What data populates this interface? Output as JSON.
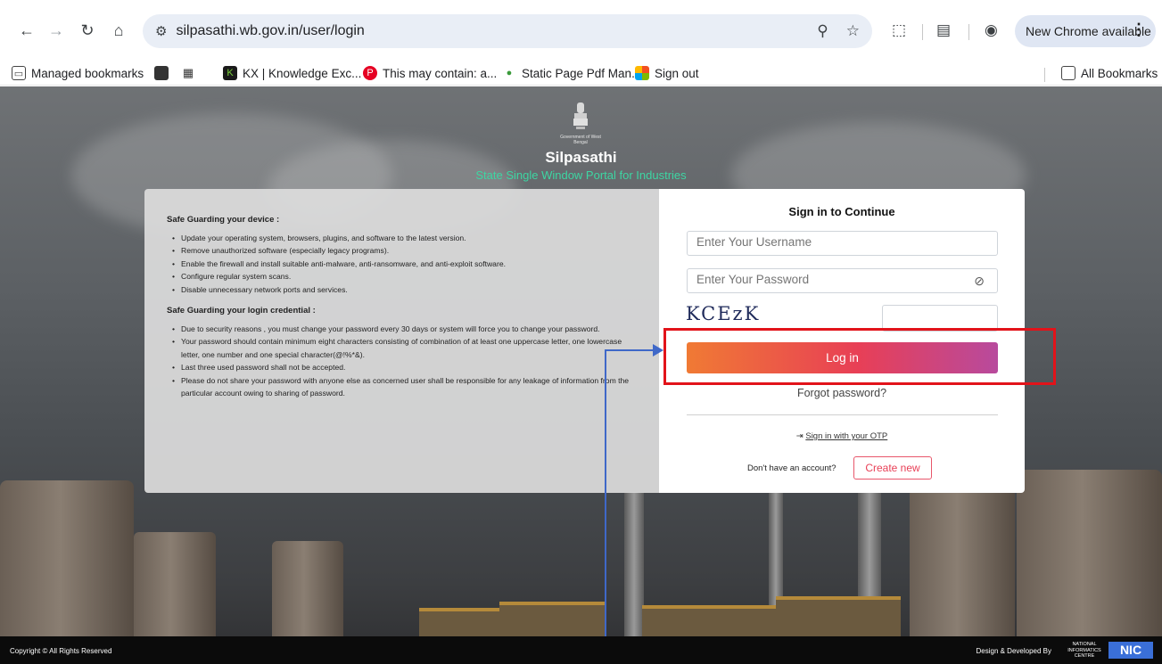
{
  "browser": {
    "url": "silpasathi.wb.gov.in/user/login",
    "update_label": "New Chrome available",
    "bookmarks": [
      {
        "label": "Managed bookmarks"
      },
      {
        "label": "KX | Knowledge Exc..."
      },
      {
        "label": "This may contain: a..."
      },
      {
        "label": "Static Page Pdf Man..."
      },
      {
        "label": "Sign out"
      }
    ],
    "all_bookmarks": "All Bookmarks"
  },
  "header": {
    "gov_text": "Government of West Bengal",
    "title": "Silpasathi",
    "subtitle": "State Single Window Portal for Industries"
  },
  "info": {
    "device_heading": "Safe Guarding your device :",
    "device_items": [
      "Update your operating system, browsers, plugins, and software to the latest version.",
      "Remove unauthorized software (especially legacy programs).",
      "Enable the firewall and install suitable anti-malware, anti-ransomware, and anti-exploit software.",
      "Configure regular system scans.",
      "Disable unnecessary network ports and services."
    ],
    "credential_heading": "Safe Guarding your login credential :",
    "credential_items": [
      "Due to security reasons , you must change your password every 30 days or system will force you to change your password.",
      "Your password should contain minimum eight characters consisting of combination of at least one uppercase letter, one lowercase letter, one number and one special character(@!%*&).",
      "Last three used password shall not be accepted.",
      "Please do not share your password with anyone else as concerned user shall be responsible for any leakage of information from the particular account owing to sharing of password."
    ]
  },
  "login": {
    "title": "Sign in to Continue",
    "username_placeholder": "Enter Your Username",
    "password_placeholder": "Enter Your Password",
    "captcha": "KCEzK",
    "login_label": "Log in",
    "forgot_label": "Forgot password?",
    "otp_label": "Sign in with your OTP",
    "no_account": "Don't have an account?",
    "create_label": "Create new"
  },
  "footer": {
    "copyright": "Copyright © All Rights Reserved",
    "design_by": "Design & Developed By",
    "nic_small": "NATIONAL INFORMATICS CENTRE",
    "nic_logo": "NIC"
  },
  "colors": {
    "accent_green": "#3dd6a3",
    "button_start": "#f07a34",
    "button_end": "#b84a9d",
    "highlight_red": "#e2131a",
    "arrow_blue": "#3f68c8"
  }
}
